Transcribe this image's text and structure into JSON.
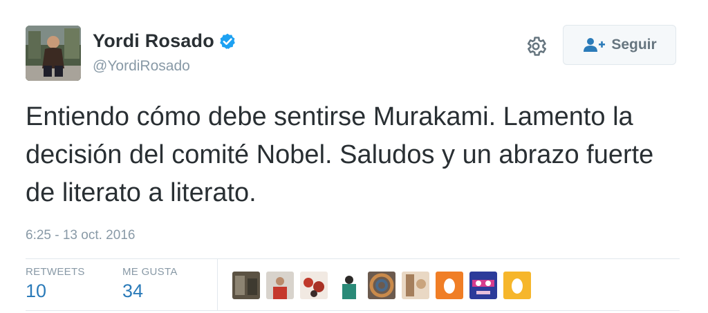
{
  "user": {
    "display_name": "Yordi Rosado",
    "handle": "@YordiRosado",
    "verified_icon": "verified-badge-icon"
  },
  "actions": {
    "settings_icon": "gear-icon",
    "follow_label": "Seguir",
    "follow_icon": "add-user-icon"
  },
  "tweet": {
    "text": "Entiendo cómo debe sentirse Murakami. Lamento la decisión del comité Nobel. Saludos y un abrazo fuerte de literato a literato.",
    "timestamp": "6:25 - 13 oct. 2016"
  },
  "stats": {
    "retweets_label": "RETWEETS",
    "retweets_value": "10",
    "likes_label": "ME GUSTA",
    "likes_value": "34"
  },
  "colors": {
    "text": "#292f33",
    "muted": "#8899a6",
    "link": "#2b7bb9",
    "verified": "#1da1f2",
    "border": "#e1e8ed"
  }
}
